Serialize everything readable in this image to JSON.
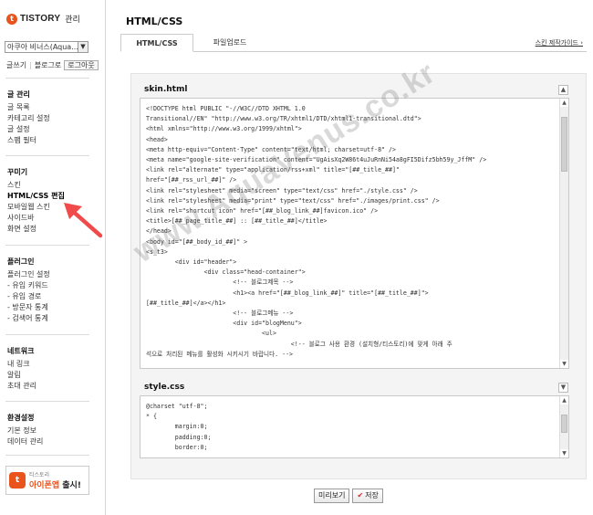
{
  "sidebar": {
    "logo_text": "TISTORY",
    "logo_sub": "관리",
    "blog_select_value": "아쿠아 비너스(Aqua...",
    "quick_links": {
      "write": "글쓰기",
      "blog": "블로그로",
      "logout": "로그아웃"
    },
    "groups": [
      {
        "title": "글 관리",
        "items": [
          "글 목록",
          "카테고리 설정",
          "글 설정",
          "스팸 필터"
        ]
      },
      {
        "title": "꾸미기",
        "items": [
          "스킨",
          "HTML/CSS 편집",
          "모바일웹 스킨",
          "사이드바",
          "화면 설정"
        ]
      },
      {
        "title": "플러그인",
        "items": [
          "플러그인 설정",
          "- 유입 키워드",
          "- 유입 경로",
          "- 방문자 통계",
          "- 검색어 통계"
        ]
      },
      {
        "title": "네트워크",
        "items": [
          "내 링크",
          "알림",
          "초대 관리"
        ]
      },
      {
        "title": "환경설정",
        "items": [
          "기본 정보",
          "데이터 관리"
        ]
      }
    ],
    "app_banner": {
      "small": "티스토리",
      "big_red": "아이폰앱",
      "big_rest": " 출시!"
    }
  },
  "main": {
    "page_title": "HTML/CSS",
    "tabs": [
      "HTML/CSS",
      "파일업로드"
    ],
    "guide_link": "스킨 제작가이드",
    "skin_section_title": "skin.html",
    "skin_code": "<!DOCTYPE html PUBLIC \"-//W3C//DTD XHTML 1.0\nTransitional//EN\" \"http://www.w3.org/TR/xhtml1/DTD/xhtml1-transitional.dtd\">\n<html xmlns=\"http://www.w3.org/1999/xhtml\">\n<head>\n<meta http-equiv=\"Content-Type\" content=\"text/html; charset=utf-8\" />\n<meta name=\"google-site-verification\" content=\"UgAisXq2W86t4uJuRnNi54a8gFI5Difz5bh59y_JffM\" />\n<link rel=\"alternate\" type=\"application/rss+xml\" title=\"[##_title_##]\"\nhref=\"[##_rss_url_##]\" />\n<link rel=\"stylesheet\" media=\"screen\" type=\"text/css\" href=\"./style.css\" />\n<link rel=\"stylesheet\" media=\"print\" type=\"text/css\" href=\"./images/print.css\" />\n<link rel=\"shortcut icon\" href=\"[##_blog_link_##]favicon.ico\" />\n<title>[##_page_title_##] :: [##_title_##]</title>\n</head>\n<body id=\"[##_body_id_##]\" >\n<s_t3>\n        <div id=\"header\">\n                <div class=\"head-container\">\n                        <!-- 블로그제목 -->\n                        <h1><a href=\"[##_blog_link_##]\" title=\"[##_title_##]\">\n[##_title_##]</a></h1>\n                        <!-- 블로그메뉴 -->\n                        <div id=\"blogMenu\">\n                                <ul>\n                                        <!-- 블로그 사용 환경 (설치형/티스토리)에 맞게 아래 주\n석으로 처리된 메뉴를 활성화 시키시기 바랍니다. -->",
    "style_section_title": "style.css",
    "style_code": "@charset \"utf-8\";\n* {\n        margin:0;\n        padding:0;\n        border:0;",
    "watermark": "www.AquaVenus.co.kr",
    "buttons": {
      "preview": "미리보기",
      "save": "저장"
    }
  }
}
